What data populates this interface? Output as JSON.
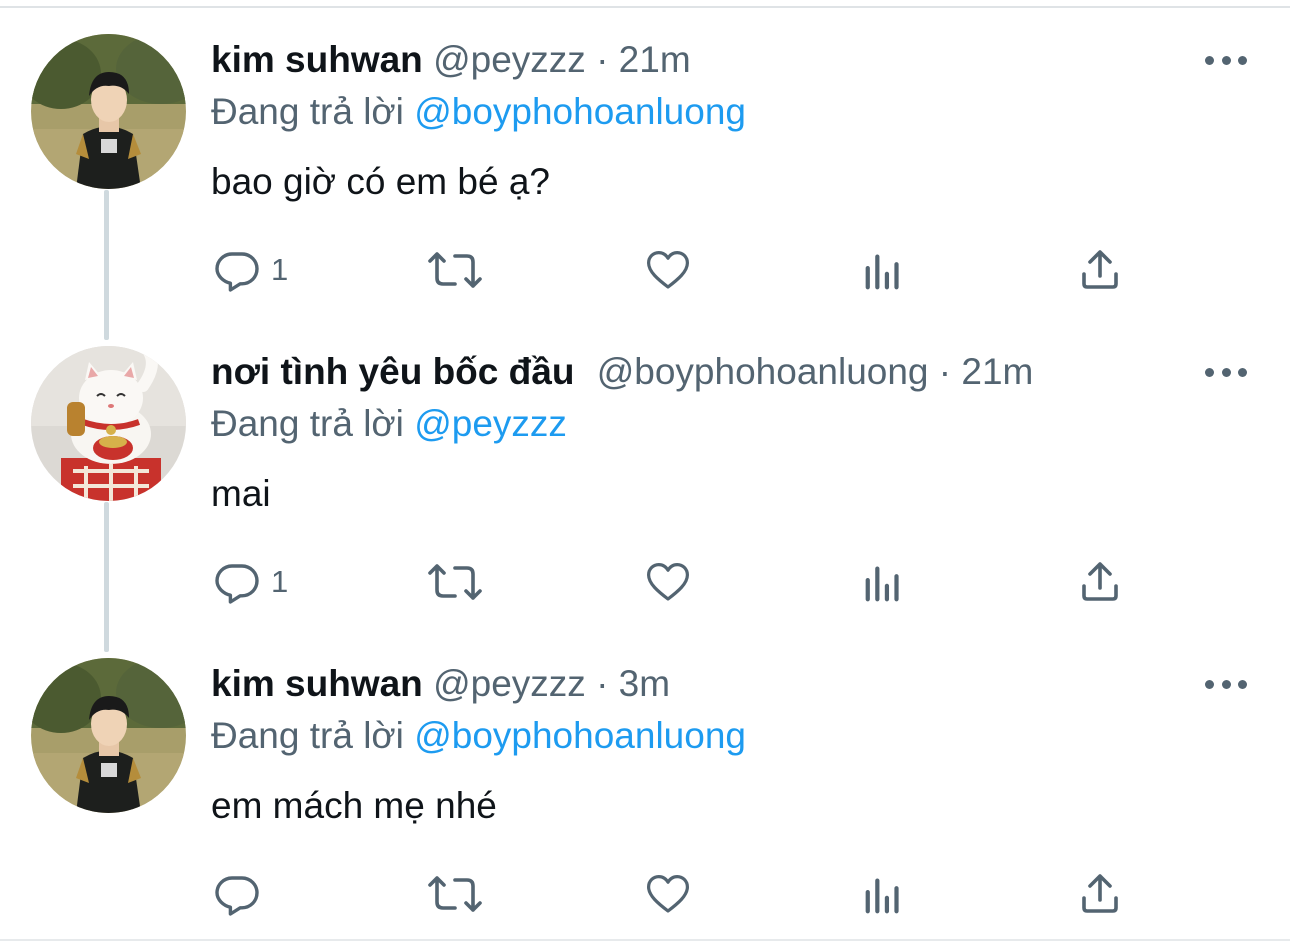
{
  "tweets": [
    {
      "name": "kim suhwan",
      "handle": "@peyzzz",
      "separator": "·",
      "time": "21m",
      "replying_prefix": "Đang trả lời",
      "replying_to": "@boyphohoanluong",
      "text": "bao giờ có em bé ạ?",
      "reply_count": "1",
      "avatar": "player-photo"
    },
    {
      "name": "nơi tình yêu bốc đầu",
      "handle": "@boyphohoanluong",
      "separator": "·",
      "time": "21m",
      "replying_prefix": "Đang trả lời",
      "replying_to": "@peyzzz",
      "text": "mai",
      "reply_count": "1",
      "avatar": "lucky-cat-photo"
    },
    {
      "name": "kim suhwan",
      "handle": "@peyzzz",
      "separator": "·",
      "time": "3m",
      "replying_prefix": "Đang trả lời",
      "replying_to": "@boyphohoanluong",
      "text": "em mách mẹ nhé",
      "reply_count": "",
      "avatar": "player-photo"
    }
  ],
  "icons": {
    "reply": "reply-icon",
    "retweet": "retweet-icon",
    "like": "heart-icon",
    "views": "views-icon",
    "share": "share-icon",
    "more": "more-icon"
  },
  "colors": {
    "text": "#0f1419",
    "secondary": "#536471",
    "link": "#1d9bf0",
    "thread_line": "#cfd9de"
  }
}
